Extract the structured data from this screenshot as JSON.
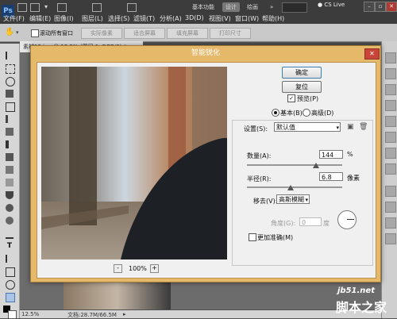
{
  "app": {
    "logo": "Ps",
    "workspace_buttons": [
      "基本功能",
      "设计",
      "绘画"
    ],
    "active_workspace": "设计",
    "cs_live": "CS Live",
    "menu": [
      "文件(F)",
      "编辑(E)",
      "图像(I)",
      "图层(L)",
      "选择(S)",
      "滤镜(T)",
      "分析(A)",
      "3D(D)",
      "视图(V)",
      "窗口(W)",
      "帮助(H)"
    ],
    "window_controls": [
      "–",
      "▫",
      "✕"
    ]
  },
  "options_bar": {
    "scroll_all_windows": "滚动所有窗口",
    "actual_pixels": "实际像素",
    "fit_screen": "适合屏幕",
    "fill_screen": "填充屏幕",
    "print_size": "打印尺寸"
  },
  "document": {
    "tab": "素材12.jpg @ 12.5% (图层 1, RGB/8) *",
    "zoom": "12.5%",
    "doc_size": "文档:28.7M/66.5M"
  },
  "dialog": {
    "title": "智能锐化",
    "close": "✕",
    "ok": "确定",
    "reset": "复位",
    "preview_label": "预览(P)",
    "preview_checked": true,
    "mode_basic": "基本(B)",
    "mode_advanced": "高级(D)",
    "mode_selected": "basic",
    "settings_label": "设置(S):",
    "settings_value": "默认值",
    "amount_label": "数量(A):",
    "amount_value": "144",
    "amount_unit": "%",
    "radius_label": "半径(R):",
    "radius_value": "6.8",
    "radius_unit": "像素",
    "remove_label": "移去(V):",
    "remove_value": "高斯模糊",
    "angle_label": "角度(G):",
    "angle_value": "0",
    "angle_unit": "度",
    "more_accurate": "更加准确(M)",
    "more_accurate_checked": false,
    "zoom_minus": "-",
    "zoom_plus": "+",
    "zoom_level": "100%"
  },
  "watermark": {
    "site": "jb51.net",
    "text": "脚本之家"
  },
  "colors": {
    "dialog_frame": "#e6b86a",
    "menubar": "#3c3c3c",
    "close_button": "#c9453a"
  }
}
